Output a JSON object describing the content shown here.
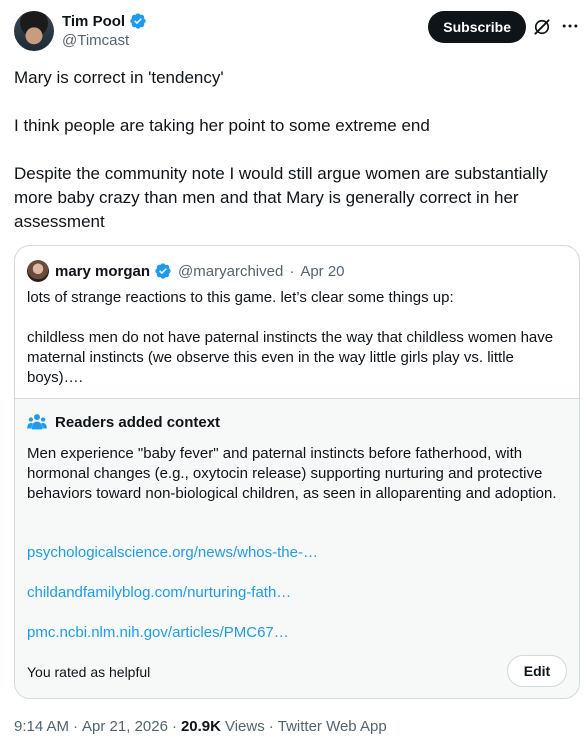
{
  "author": {
    "name": "Tim Pool",
    "handle": "@Timcast"
  },
  "header": {
    "subscribe_label": "Subscribe",
    "grok_icon": "grok-icon",
    "more_icon": "more-icon"
  },
  "tweet": {
    "paragraphs": [
      "Mary is correct in 'tendency'",
      "I think people are taking her point to some extreme end",
      "Despite the community note I would still argue women are substantially more baby crazy than men and that Mary is generally correct in her assessment"
    ]
  },
  "quote": {
    "name": "mary morgan",
    "handle": "@maryarchived",
    "dot": "·",
    "date": "Apr 20",
    "paragraphs": [
      "lots of strange reactions to this game. let’s clear some things up:",
      "childless men do not have paternal instincts the way that childless women have maternal instincts (we observe this even in the way little girls play vs. little boys)…."
    ]
  },
  "note": {
    "title": "Readers added context",
    "body": "Men experience \"baby fever\" and paternal instincts before fatherhood, with hormonal changes (e.g., oxytocin release) supporting nurturing and protective behaviors toward non-biological children, as seen in alloparenting and adoption.",
    "links": [
      "psychologicalscience.org/news/whos-the-…",
      "childandfamilyblog.com/nurturing-fath…",
      "pmc.ncbi.nlm.nih.gov/articles/PMC67…"
    ],
    "rated_text": "You rated as helpful",
    "edit_label": "Edit"
  },
  "meta": {
    "time": "9:14 AM",
    "sep1": "·",
    "date": "Apr 21, 2026",
    "sep2": "·",
    "views_count": "20.9K",
    "views_label": "Views",
    "sep3": "·",
    "source": "Twitter Web App"
  },
  "colors": {
    "accent": "#1d9bf0",
    "text": "#0f1419",
    "muted": "#536471",
    "border": "#cfd9de",
    "note_bg": "#f7f9f9"
  }
}
